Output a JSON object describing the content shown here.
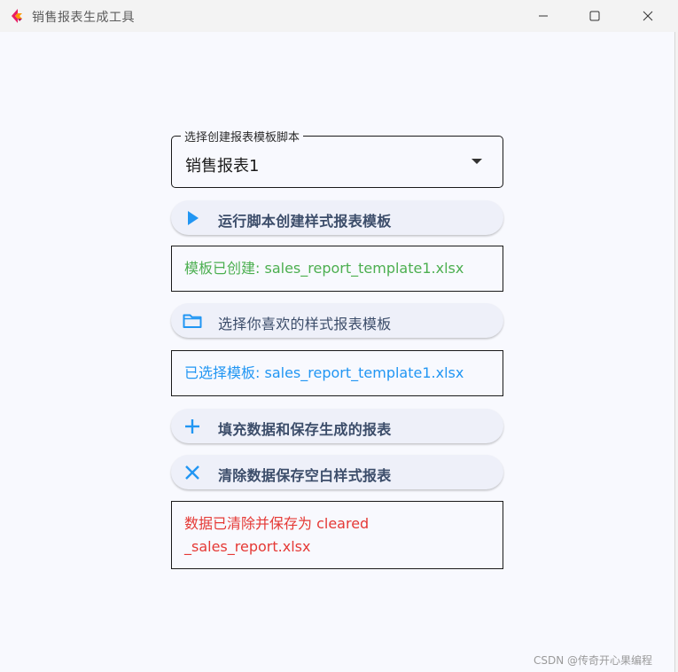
{
  "window": {
    "title": "销售报表生成工具",
    "icon": "flutter-logo-icon"
  },
  "template_select": {
    "legend": "选择创建报表模板脚本",
    "selected": "销售报表1"
  },
  "buttons": {
    "run_script": {
      "label": "运行脚本创建样式报表模板",
      "icon": "play-icon"
    },
    "choose_template": {
      "label": "选择你喜欢的样式报表模板",
      "icon": "folder-icon"
    },
    "fill_save": {
      "label": "填充数据和保存生成的报表",
      "icon": "plus-icon"
    },
    "clear_save": {
      "label": "清除数据保存空白样式报表",
      "icon": "close-icon"
    }
  },
  "status": {
    "created": "模板已创建: sales_report_template1.xlsx",
    "selected": "已选择模板: sales_report_template1.xlsx",
    "cleared": "数据已清除并保存为 cleared_sales_report.xlsx"
  },
  "colors": {
    "created": "#4caf50",
    "selected": "#2196f3",
    "cleared": "#e53935",
    "icon_blue": "#2196f3",
    "button_text": "#3c4d6a"
  },
  "watermark": "CSDN @传奇开心果编程"
}
